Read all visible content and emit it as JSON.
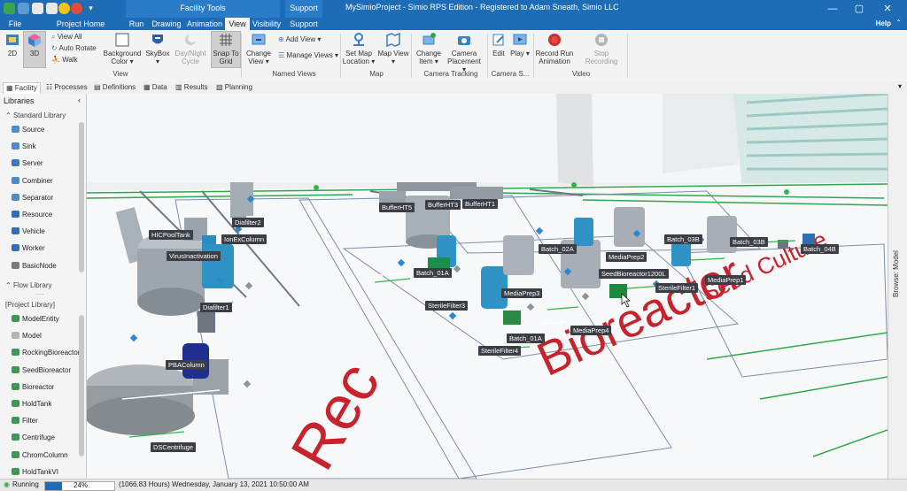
{
  "window": {
    "app_title": "MySimioProject - Simio RPS Edition - Registered to Adam Sneath, Simio LLC",
    "context_tab_facility_tools": "Facility Tools",
    "context_tab_support": "Support"
  },
  "tabs": [
    {
      "label": "File"
    },
    {
      "label": "Project Home"
    },
    {
      "label": "Run"
    },
    {
      "label": "Drawing"
    },
    {
      "label": "Animation"
    },
    {
      "label": "View"
    },
    {
      "label": "Visibility"
    },
    {
      "label": "Support"
    }
  ],
  "help_label": "Help",
  "ribbon": {
    "view_2d": "2D",
    "view_3d": "3D",
    "view_all": "View All",
    "auto_rotate": "Auto Rotate",
    "walk": "Walk",
    "background_color": "Background Color",
    "skybox": "SkyBox",
    "day_night_cycle": "Day/Night Cycle",
    "snap_to_grid": "Snap To Grid",
    "change_view": "Change View",
    "add_view": "Add View",
    "manage_views": "Manage Views",
    "set_map_location": "Set Map Location",
    "map_view": "Map View",
    "change_item": "Change Item",
    "camera_placement": "Camera Placement",
    "edit": "Edit",
    "play": "Play",
    "record_run_animation": "Record Run Animation",
    "stop_recording": "Stop Recording",
    "groups": {
      "view": "View",
      "named_views": "Named Views",
      "map": "Map",
      "camera_tracking": "Camera Tracking",
      "camera_s": "Camera S...",
      "video": "Video"
    }
  },
  "view_tabs": [
    {
      "label": "Facility"
    },
    {
      "label": "Processes"
    },
    {
      "label": "Definitions"
    },
    {
      "label": "Data"
    },
    {
      "label": "Results"
    },
    {
      "label": "Planning"
    }
  ],
  "libraries": {
    "title": "Libraries",
    "standard_library": "Standard Library",
    "standard_items": [
      {
        "label": "Source",
        "color": "#4a8ccf"
      },
      {
        "label": "Sink",
        "color": "#4a8ccf"
      },
      {
        "label": "Server",
        "color": "#3a78bf"
      },
      {
        "label": "Combiner",
        "color": "#4a8ccf"
      },
      {
        "label": "Separator",
        "color": "#4a8ccf"
      },
      {
        "label": "Resource",
        "color": "#2d6fb8"
      },
      {
        "label": "Vehicle",
        "color": "#2d6fb8"
      },
      {
        "label": "Worker",
        "color": "#2d6fb8"
      },
      {
        "label": "BasicNode",
        "color": "#7a7a7a"
      }
    ],
    "flow_library": "Flow Library",
    "project_library": "[Project Library]",
    "project_items": [
      {
        "label": "ModelEntity",
        "color": "#3a9b52"
      },
      {
        "label": "Model",
        "color": "#b5b5b5"
      },
      {
        "label": "RockingBioreactor",
        "color": "#3a9b52"
      },
      {
        "label": "SeedBioreactor",
        "color": "#3a9b52"
      },
      {
        "label": "Bioreactor",
        "color": "#3a9b52"
      },
      {
        "label": "HoldTank",
        "color": "#3a9b52"
      },
      {
        "label": "Filter",
        "color": "#3a9b52"
      },
      {
        "label": "Centrifuge",
        "color": "#3a9b52"
      },
      {
        "label": "ChromColumn",
        "color": "#3a9b52"
      },
      {
        "label": "HoldTankVI",
        "color": "#3a9b52"
      }
    ]
  },
  "facility": {
    "floor_text_bioreactor": "Bioreactor",
    "floor_text_seed_culture": "Seed Culture",
    "floor_text_rec": "Rec",
    "labels": [
      "Diafilter2",
      "HICPoolTank",
      "IonExColumn",
      "VirusInactivation",
      "Diafilter1",
      "PBAColumn",
      "DSCentrifuge",
      "BufferHT5",
      "BufferHT3",
      "BufferHT1",
      "Batch_02A",
      "MediaPrep2",
      "Batch_03B",
      "Batch_03B",
      "Batch_04B",
      "SeedBioreactor1200L",
      "Batch_01A",
      "SterileFilter3",
      "MediaPrep3",
      "SterileFilter1",
      "MediaPrep1",
      "Batch_01A",
      "SterileFilter4",
      "MediaPrep4"
    ]
  },
  "browse_label": "Browse: Model",
  "status": {
    "state": "Running",
    "progress_percent": 24,
    "progress_label": "24%",
    "time_text": "(1066.83 Hours) Wednesday, January 13, 2021 10:50:00 AM"
  }
}
